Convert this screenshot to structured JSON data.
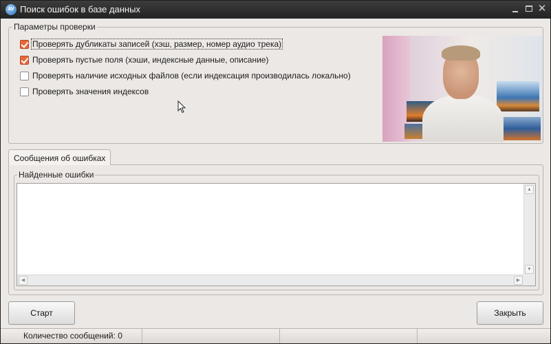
{
  "window": {
    "title": "Поиск ошибок в базе данных",
    "icon_text": "AV"
  },
  "params": {
    "legend": "Параметры проверки",
    "options": [
      {
        "label": "Проверять дубликаты записей (хэш, размер, номер аудио трека)",
        "checked": true
      },
      {
        "label": "Проверять пустые поля (хэши, индексные данные, описание)",
        "checked": true
      },
      {
        "label": "Проверять наличие исходных файлов (если индексация производилась локально)",
        "checked": false
      },
      {
        "label": "Проверять значения индексов",
        "checked": false
      }
    ]
  },
  "tabs": [
    {
      "label": "Сообщения об ошибках",
      "active": true
    }
  ],
  "errors": {
    "legend": "Найденные ошибки",
    "items": []
  },
  "buttons": {
    "start": "Старт",
    "close": "Закрыть"
  },
  "status": {
    "message_count": "Количество сообщений: 0"
  },
  "colors": {
    "accent_checkbox": "#e8693a",
    "titlebar": "#2d2d2d",
    "window_bg": "#ece8e5"
  },
  "icons": {
    "minimize": "minimize-icon",
    "maximize": "maximize-icon",
    "close": "close-icon",
    "cursor": "mouse-pointer-icon"
  }
}
